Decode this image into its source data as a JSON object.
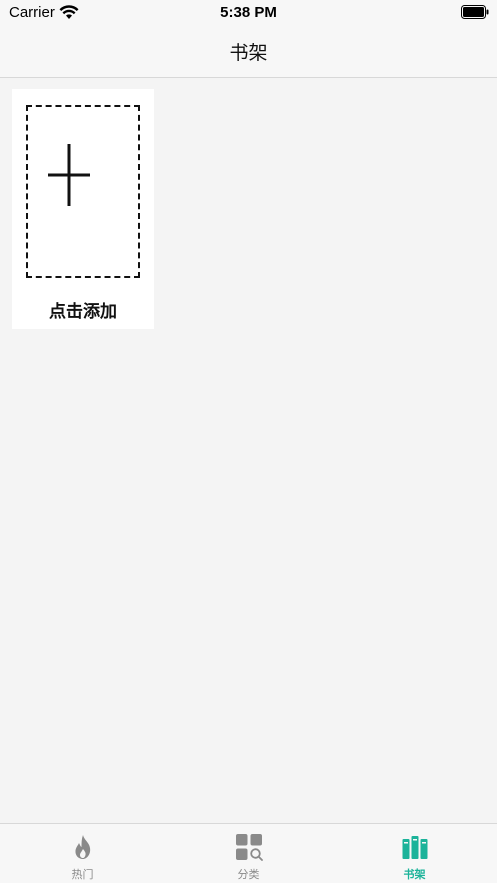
{
  "status_bar": {
    "carrier": "Carrier",
    "time": "5:38 PM"
  },
  "nav": {
    "title": "书架"
  },
  "add_card": {
    "label": "点击添加",
    "icon": "plus-icon"
  },
  "tabs": [
    {
      "label": "热门",
      "icon": "flame-icon",
      "active": false
    },
    {
      "label": "分类",
      "icon": "category-search-icon",
      "active": false
    },
    {
      "label": "书架",
      "icon": "bookshelf-icon",
      "active": true
    }
  ],
  "colors": {
    "accent": "#1bb39a",
    "inactive": "#8a8a8a",
    "background": "#f4f4f4",
    "bar": "#f7f7f7"
  }
}
